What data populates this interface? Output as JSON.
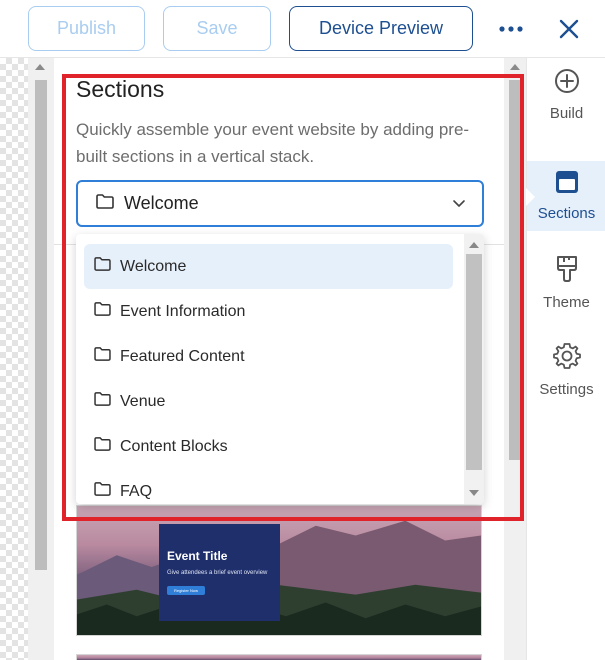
{
  "toolbar": {
    "publish_label": "Publish",
    "save_label": "Save",
    "preview_label": "Device Preview",
    "more_icon": "more-horizontal-icon",
    "close_icon": "close-icon"
  },
  "panel": {
    "title": "Sections",
    "description": "Quickly assemble your event website by adding pre-built sections in a vertical stack.",
    "select": {
      "value": "Welcome",
      "icon": "folder-icon"
    },
    "options": [
      {
        "label": "Welcome",
        "selected": true
      },
      {
        "label": "Event Information",
        "selected": false
      },
      {
        "label": "Featured Content",
        "selected": false
      },
      {
        "label": "Venue",
        "selected": false
      },
      {
        "label": "Content Blocks",
        "selected": false
      },
      {
        "label": "FAQ",
        "selected": false
      }
    ],
    "preview_card": {
      "title": "Event Title",
      "subtitle": "Give attendees a brief event overview",
      "button": "Register Now"
    }
  },
  "sidebar": {
    "items": [
      {
        "label": "Build",
        "icon": "plus-circle-icon",
        "active": false
      },
      {
        "label": "Sections",
        "icon": "section-icon",
        "active": true
      },
      {
        "label": "Theme",
        "icon": "paintbrush-icon",
        "active": false
      },
      {
        "label": "Settings",
        "icon": "gear-icon",
        "active": false
      }
    ]
  },
  "colors": {
    "accent": "#1d4f91",
    "focus_border": "#2f7ed8",
    "highlight": "#e0222a",
    "selected_bg": "#e6f0fb"
  }
}
